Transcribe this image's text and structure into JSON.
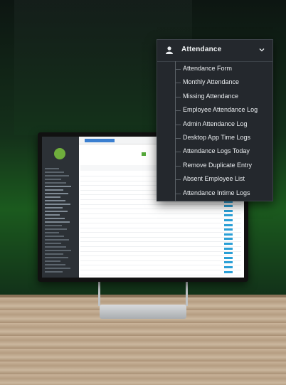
{
  "dropdown": {
    "title": "Attendance",
    "header_icon": "user-icon",
    "chevron_icon": "chevron-down-icon",
    "items": [
      {
        "label": "Attendance Form"
      },
      {
        "label": "Monthly Attendance"
      },
      {
        "label": "Missing Attendance"
      },
      {
        "label": "Employee Attendance Log"
      },
      {
        "label": "Admin Attendance Log"
      },
      {
        "label": "Desktop App Time Logs"
      },
      {
        "label": "Attendance Logs Today"
      },
      {
        "label": "Remove Duplicate Entry"
      },
      {
        "label": "Absent Employee List"
      },
      {
        "label": "Attendance Intime Logs"
      }
    ]
  },
  "colors": {
    "dropdown_bg": "#24282d",
    "sidebar_bg": "#2c3136",
    "accent_green": "#55a83a",
    "accent_blue": "#2a9fd6"
  }
}
